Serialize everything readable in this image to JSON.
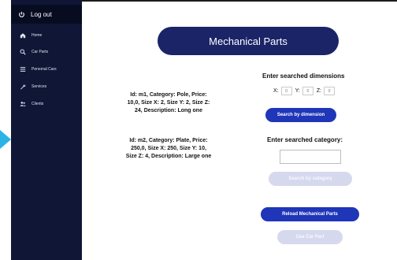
{
  "sidebar": {
    "logout_label": "Log out",
    "items": [
      {
        "label": "Home",
        "icon": "home-icon"
      },
      {
        "label": "Car Parts",
        "icon": "search-icon"
      },
      {
        "label": "Personal Cars",
        "icon": "list-icon"
      },
      {
        "label": "Services",
        "icon": "wrench-icon"
      },
      {
        "label": "Clients",
        "icon": "users-icon"
      }
    ]
  },
  "main": {
    "title": "Mechanical Parts",
    "parts": [
      "Id: m1, Category: Pole, Price: 10,0, Size X: 2, Size Y: 2, Size Z: 24, Description: Long one",
      "Id: m2, Category: Plate, Price: 250,0, Size X: 250, Size Y: 10, Size Z: 4, Description: Large one"
    ],
    "dimension_heading": "Enter searched dimensions",
    "dims": {
      "x_label": "X:",
      "y_label": "Y:",
      "z_label": "Z:",
      "x_value": "0",
      "y_value": "0",
      "z_value": "0"
    },
    "search_dimension_label": "Search by dimension",
    "category_heading": "Enter searched category:",
    "category_value": "",
    "search_category_label": "Search by category",
    "reload_label": "Reload Mechanical Parts",
    "use_part_label": "Use Car Part"
  },
  "colors": {
    "sidebar_bg": "#0f1636",
    "title_bg": "#1a2467",
    "primary_button": "#1f36b8",
    "disabled_button": "#d6d9ee",
    "accent_arrow": "#2ab4e6"
  }
}
